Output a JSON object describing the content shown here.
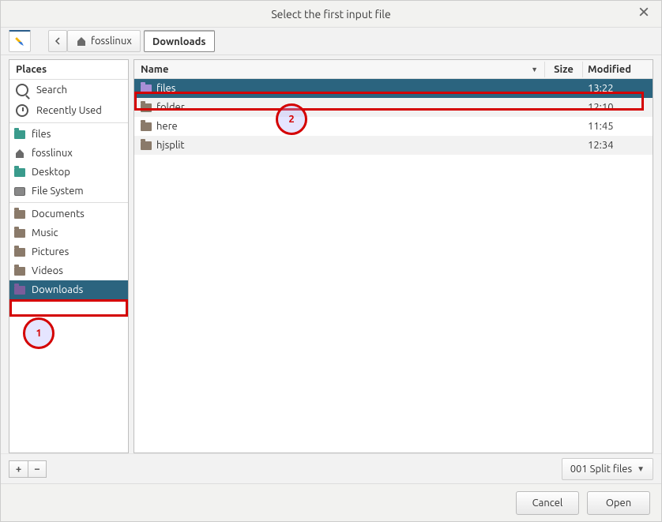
{
  "title": "Select the first input file",
  "toolbar": {
    "back_tooltip": "Back"
  },
  "breadcrumbs": {
    "prev": "fosslinux",
    "current": "Downloads"
  },
  "sidebar": {
    "header": "Places",
    "search": "Search",
    "recent": "Recently Used",
    "items_a": [
      {
        "label": "files",
        "icon": "teal"
      },
      {
        "label": "fosslinux",
        "icon": "home"
      },
      {
        "label": "Desktop",
        "icon": "teal"
      },
      {
        "label": "File System",
        "icon": "drive"
      }
    ],
    "items_b": [
      {
        "label": "Documents"
      },
      {
        "label": "Music"
      },
      {
        "label": "Pictures"
      },
      {
        "label": "Videos"
      },
      {
        "label": "Downloads",
        "selected": true
      }
    ]
  },
  "file_headers": {
    "name": "Name",
    "size": "Size",
    "modified": "Modified"
  },
  "files": [
    {
      "name": "files",
      "size": "",
      "modified": "13:22",
      "selected": true,
      "icon": "sel"
    },
    {
      "name": "folder",
      "size": "",
      "modified": "12:10",
      "selected": false,
      "icon": "plain"
    },
    {
      "name": "here",
      "size": "",
      "modified": "11:45",
      "selected": false,
      "icon": "plain"
    },
    {
      "name": "hjsplit",
      "size": "",
      "modified": "12:34",
      "selected": false,
      "icon": "plain"
    }
  ],
  "filter": {
    "label": "001 Split files"
  },
  "buttons": {
    "cancel": "Cancel",
    "open": "Open"
  },
  "annotations": {
    "one": "1",
    "two": "2"
  }
}
